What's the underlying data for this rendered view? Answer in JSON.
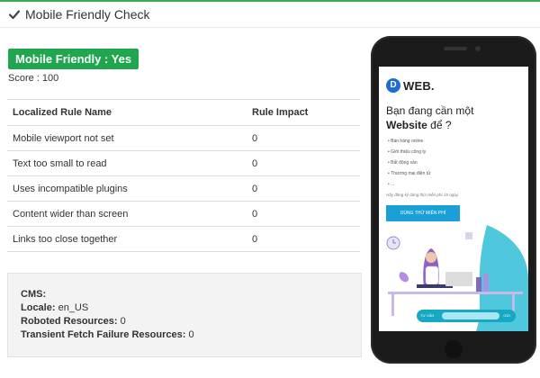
{
  "header": {
    "title": "Mobile Friendly Check",
    "icon": "check-icon"
  },
  "result": {
    "badge": "Mobile Friendly : Yes",
    "score": "Score : 100"
  },
  "table": {
    "columns": [
      "Localized Rule Name",
      "Rule Impact"
    ],
    "rows": [
      [
        "Mobile viewport not set",
        "0"
      ],
      [
        "Text too small to read",
        "0"
      ],
      [
        "Uses incompatible plugins",
        "0"
      ],
      [
        "Content wider than screen",
        "0"
      ],
      [
        "Links too close together",
        "0"
      ]
    ]
  },
  "info": {
    "cms_label": "CMS:",
    "cms_value": "",
    "locale_label": "Locale:",
    "locale_value": "en_US",
    "roboted_label": "Roboted Resources:",
    "roboted_value": "0",
    "transient_label": "Transient Fetch Failure Resources:",
    "transient_value": "0"
  },
  "phone_preview": {
    "logo_letter": "D",
    "logo_text": "WEB.",
    "headline_line1": "Bạn đang cần một",
    "headline_bold": "Website",
    "headline_tail": "để ?",
    "bullets": [
      "Bán hàng online",
      "Giới thiệu công ty",
      "Bất động sản",
      "Thương mại điện tử",
      "..."
    ],
    "note": "Hãy đăng ký dùng thử miễn phí 15 ngày.",
    "cta_label": "DÙNG THỬ MIỄN PHÍ",
    "bar_left": "TƯ VẤN",
    "bar_right": "GỬI"
  },
  "colors": {
    "accent": "#1fa64e",
    "top_line": "#3aaa5c",
    "phone_cta": "#1a9fd6",
    "phone_bar": "#17a9c4"
  }
}
